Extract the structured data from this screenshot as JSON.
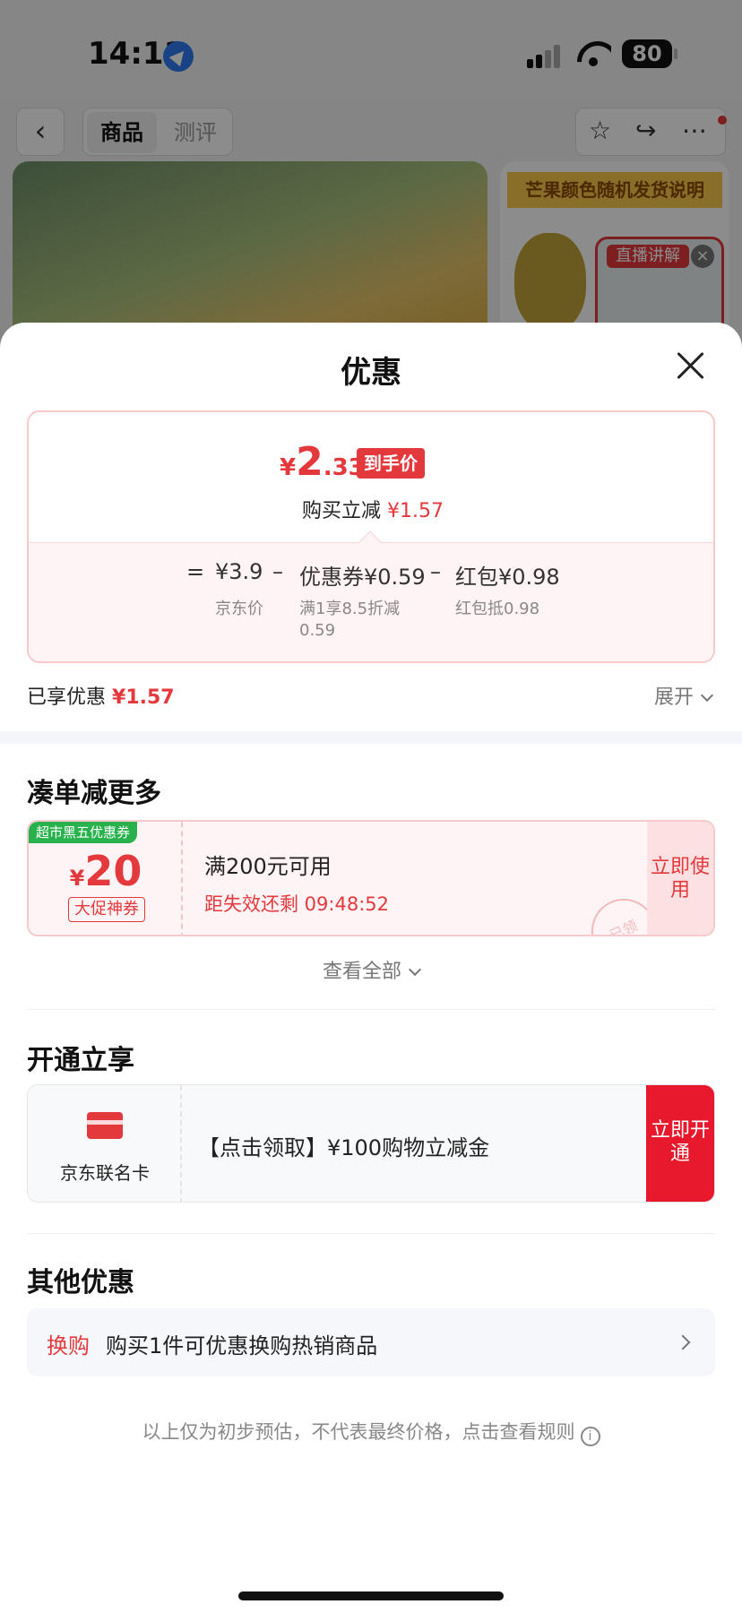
{
  "status_bar": {
    "time": "14:11",
    "battery": "80"
  },
  "product_page": {
    "tabs": [
      "商品",
      "测评"
    ],
    "banner": "芒果颜色随机发货说明",
    "live_label": "直播讲解"
  },
  "sheet": {
    "title": "优惠",
    "price_card": {
      "hand_price_yen": "¥",
      "hand_price_int": "2",
      "hand_price_dec": ".33",
      "hand_price_badge": "到手价",
      "reduce_label": "购买立减",
      "reduce_value": "¥1.57",
      "formula": {
        "equals": "=",
        "base_price": "¥3.9",
        "minus1": "–",
        "coupon": "优惠券¥0.59",
        "minus2": "–",
        "red_packet": "红包¥0.98"
      },
      "notes": {
        "base": "京东价",
        "coupon_line1": "满1享8.5折减",
        "coupon_line2": "0.59",
        "red_packet": "红包抵0.98"
      }
    },
    "enjoyed": {
      "label": "已享优惠",
      "value": "¥1.57",
      "expand": "展开"
    },
    "more_section": {
      "title": "凑单减更多",
      "coupon": {
        "tag": "超市黑五优惠券",
        "yen": "¥",
        "amount": "20",
        "kind": "大促神券",
        "condition": "满200元可用",
        "countdown": "距失效还剩 09:48:52",
        "stamp": "已领",
        "button": "立即使用"
      },
      "view_all": "查看全部"
    },
    "open_section": {
      "title": "开通立享",
      "card_name": "京东联名卡",
      "offer": "【点击领取】¥100购物立减金",
      "button": "立即开通"
    },
    "other_section": {
      "title": "其他优惠",
      "tag": "换购",
      "text": "购买1件可优惠换购热销商品"
    },
    "disclaimer": "以上仅为初步预估，不代表最终价格，点击查看规则"
  },
  "colors": {
    "accent_red": "#e4393c",
    "green_tag": "#28b14c"
  }
}
